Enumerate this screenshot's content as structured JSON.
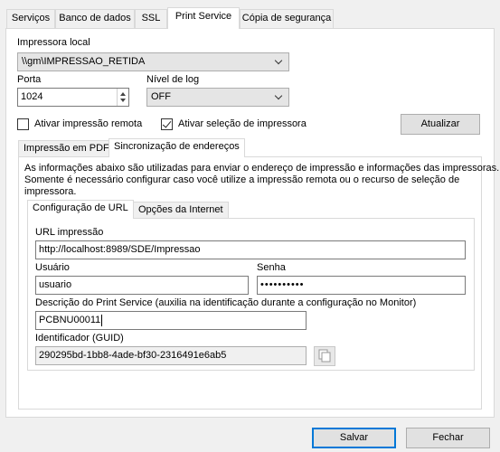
{
  "tabs": [
    "Serviços",
    "Banco de dados",
    "SSL",
    "Print Service",
    "Cópia de segurança"
  ],
  "active_tab": "Print Service",
  "printer": {
    "label": "Impressora local",
    "value": "\\\\gm\\IMPRESSAO_RETIDA"
  },
  "port": {
    "label": "Porta",
    "value": "1024"
  },
  "log_level": {
    "label": "Nível de log",
    "value": "OFF"
  },
  "remote_print": {
    "label": "Ativar impressão remota",
    "checked": false
  },
  "printer_selection": {
    "label": "Ativar seleção de impressora",
    "checked": true
  },
  "update_button": "Atualizar",
  "subtabs": [
    "Impressão em PDF",
    "Sincronização de endereços"
  ],
  "active_subtab": "Sincronização de endereços",
  "sync": {
    "description_line1": "As informações abaixo são utilizadas para enviar o endereço de impressão e informações das impressoras.",
    "description_line2": "Somente é necessário configurar caso você utilize a impressão remota ou o recurso de seleção de",
    "description_line3": "impressora.",
    "inner_tabs": [
      "Configuração de URL",
      "Opções da Internet"
    ],
    "url": {
      "label": "URL impressão",
      "value": "http://localhost:8989/SDE/Impressao"
    },
    "user": {
      "label": "Usuário",
      "value": "usuario"
    },
    "password": {
      "label": "Senha",
      "value": "••••••••••"
    },
    "service_description": {
      "label": "Descrição do Print Service (auxilia na identificação durante a configuração no Monitor)",
      "value": "PCBNU00011"
    },
    "guid": {
      "label": "Identificador (GUID)",
      "value": "290295bd-1bb8-4ade-bf30-2316491e6ab5"
    }
  },
  "footer": {
    "save": "Salvar",
    "close": "Fechar"
  }
}
